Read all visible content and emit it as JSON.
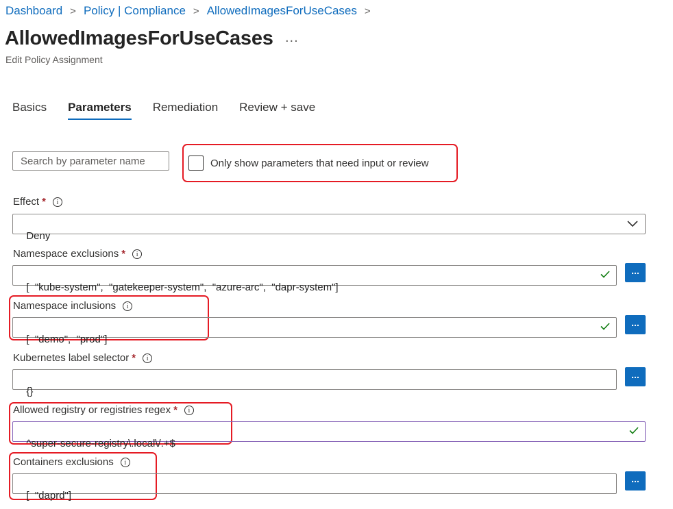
{
  "breadcrumb": {
    "items": [
      "Dashboard",
      "Policy | Compliance",
      "AllowedImagesForUseCases"
    ],
    "separator": ">"
  },
  "page": {
    "title": "AllowedImagesForUseCases",
    "more_label": "...",
    "subtitle": "Edit Policy Assignment"
  },
  "tabs": [
    "Basics",
    "Parameters",
    "Remediation",
    "Review + save"
  ],
  "active_tab": "Parameters",
  "search": {
    "placeholder": "Search by parameter name",
    "value": ""
  },
  "filter": {
    "label": "Only show parameters that need input or review",
    "checked": false
  },
  "fields": {
    "effect": {
      "label": "Effect",
      "required": "*",
      "info": "i",
      "value": "Deny"
    },
    "namespace_exclusions": {
      "label": "Namespace exclusions",
      "required": "*",
      "info": "i",
      "value": "[  \"kube-system\",  \"gatekeeper-system\",  \"azure-arc\",  \"dapr-system\"]",
      "button": "..."
    },
    "namespace_inclusions": {
      "label": "Namespace inclusions",
      "info": "i",
      "value": "[  \"demo\",  \"prod\"]",
      "button": "..."
    },
    "label_selector": {
      "label": "Kubernetes label selector",
      "required": "*",
      "info": "i",
      "value": "{}",
      "button": "..."
    },
    "allowed_registry": {
      "label": "Allowed registry or registries regex",
      "required": "*",
      "info": "i",
      "value": "^super-secure-registry\\.local\\/.+$"
    },
    "containers_exclusions": {
      "label": "Containers exclusions",
      "info": "i",
      "value": "[  \"daprd\"]",
      "button": "..."
    }
  },
  "colors": {
    "accent": "#0f6cbd",
    "valid_check": "#107c10",
    "required_star": "#a4262c",
    "highlight": "#e51b24"
  },
  "icons": {
    "valid": "checkmark-icon",
    "dropdown": "chevron-down-icon",
    "info": "info-icon",
    "more": "more-icon"
  }
}
